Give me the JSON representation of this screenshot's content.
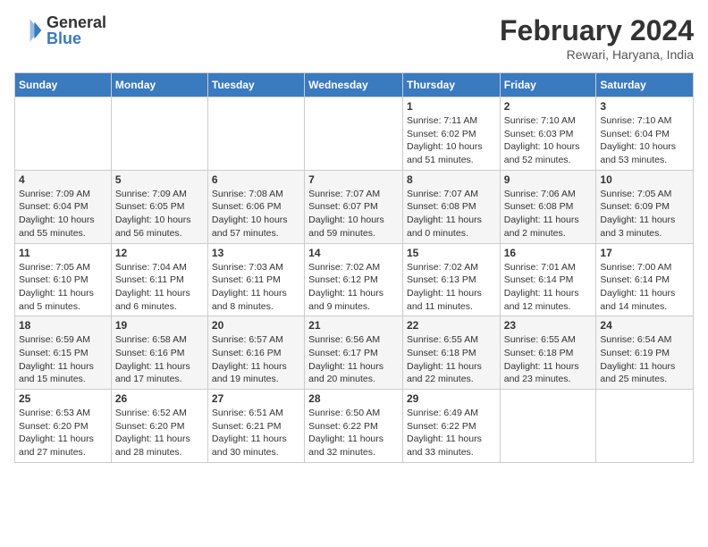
{
  "header": {
    "logo_general": "General",
    "logo_blue": "Blue",
    "month_year": "February 2024",
    "location": "Rewari, Haryana, India"
  },
  "days_of_week": [
    "Sunday",
    "Monday",
    "Tuesday",
    "Wednesday",
    "Thursday",
    "Friday",
    "Saturday"
  ],
  "weeks": [
    [
      {
        "day": "",
        "info": ""
      },
      {
        "day": "",
        "info": ""
      },
      {
        "day": "",
        "info": ""
      },
      {
        "day": "",
        "info": ""
      },
      {
        "day": "1",
        "info": "Sunrise: 7:11 AM\nSunset: 6:02 PM\nDaylight: 10 hours\nand 51 minutes."
      },
      {
        "day": "2",
        "info": "Sunrise: 7:10 AM\nSunset: 6:03 PM\nDaylight: 10 hours\nand 52 minutes."
      },
      {
        "day": "3",
        "info": "Sunrise: 7:10 AM\nSunset: 6:04 PM\nDaylight: 10 hours\nand 53 minutes."
      }
    ],
    [
      {
        "day": "4",
        "info": "Sunrise: 7:09 AM\nSunset: 6:04 PM\nDaylight: 10 hours\nand 55 minutes."
      },
      {
        "day": "5",
        "info": "Sunrise: 7:09 AM\nSunset: 6:05 PM\nDaylight: 10 hours\nand 56 minutes."
      },
      {
        "day": "6",
        "info": "Sunrise: 7:08 AM\nSunset: 6:06 PM\nDaylight: 10 hours\nand 57 minutes."
      },
      {
        "day": "7",
        "info": "Sunrise: 7:07 AM\nSunset: 6:07 PM\nDaylight: 10 hours\nand 59 minutes."
      },
      {
        "day": "8",
        "info": "Sunrise: 7:07 AM\nSunset: 6:08 PM\nDaylight: 11 hours\nand 0 minutes."
      },
      {
        "day": "9",
        "info": "Sunrise: 7:06 AM\nSunset: 6:08 PM\nDaylight: 11 hours\nand 2 minutes."
      },
      {
        "day": "10",
        "info": "Sunrise: 7:05 AM\nSunset: 6:09 PM\nDaylight: 11 hours\nand 3 minutes."
      }
    ],
    [
      {
        "day": "11",
        "info": "Sunrise: 7:05 AM\nSunset: 6:10 PM\nDaylight: 11 hours\nand 5 minutes."
      },
      {
        "day": "12",
        "info": "Sunrise: 7:04 AM\nSunset: 6:11 PM\nDaylight: 11 hours\nand 6 minutes."
      },
      {
        "day": "13",
        "info": "Sunrise: 7:03 AM\nSunset: 6:11 PM\nDaylight: 11 hours\nand 8 minutes."
      },
      {
        "day": "14",
        "info": "Sunrise: 7:02 AM\nSunset: 6:12 PM\nDaylight: 11 hours\nand 9 minutes."
      },
      {
        "day": "15",
        "info": "Sunrise: 7:02 AM\nSunset: 6:13 PM\nDaylight: 11 hours\nand 11 minutes."
      },
      {
        "day": "16",
        "info": "Sunrise: 7:01 AM\nSunset: 6:14 PM\nDaylight: 11 hours\nand 12 minutes."
      },
      {
        "day": "17",
        "info": "Sunrise: 7:00 AM\nSunset: 6:14 PM\nDaylight: 11 hours\nand 14 minutes."
      }
    ],
    [
      {
        "day": "18",
        "info": "Sunrise: 6:59 AM\nSunset: 6:15 PM\nDaylight: 11 hours\nand 15 minutes."
      },
      {
        "day": "19",
        "info": "Sunrise: 6:58 AM\nSunset: 6:16 PM\nDaylight: 11 hours\nand 17 minutes."
      },
      {
        "day": "20",
        "info": "Sunrise: 6:57 AM\nSunset: 6:16 PM\nDaylight: 11 hours\nand 19 minutes."
      },
      {
        "day": "21",
        "info": "Sunrise: 6:56 AM\nSunset: 6:17 PM\nDaylight: 11 hours\nand 20 minutes."
      },
      {
        "day": "22",
        "info": "Sunrise: 6:55 AM\nSunset: 6:18 PM\nDaylight: 11 hours\nand 22 minutes."
      },
      {
        "day": "23",
        "info": "Sunrise: 6:55 AM\nSunset: 6:18 PM\nDaylight: 11 hours\nand 23 minutes."
      },
      {
        "day": "24",
        "info": "Sunrise: 6:54 AM\nSunset: 6:19 PM\nDaylight: 11 hours\nand 25 minutes."
      }
    ],
    [
      {
        "day": "25",
        "info": "Sunrise: 6:53 AM\nSunset: 6:20 PM\nDaylight: 11 hours\nand 27 minutes."
      },
      {
        "day": "26",
        "info": "Sunrise: 6:52 AM\nSunset: 6:20 PM\nDaylight: 11 hours\nand 28 minutes."
      },
      {
        "day": "27",
        "info": "Sunrise: 6:51 AM\nSunset: 6:21 PM\nDaylight: 11 hours\nand 30 minutes."
      },
      {
        "day": "28",
        "info": "Sunrise: 6:50 AM\nSunset: 6:22 PM\nDaylight: 11 hours\nand 32 minutes."
      },
      {
        "day": "29",
        "info": "Sunrise: 6:49 AM\nSunset: 6:22 PM\nDaylight: 11 hours\nand 33 minutes."
      },
      {
        "day": "",
        "info": ""
      },
      {
        "day": "",
        "info": ""
      }
    ]
  ]
}
